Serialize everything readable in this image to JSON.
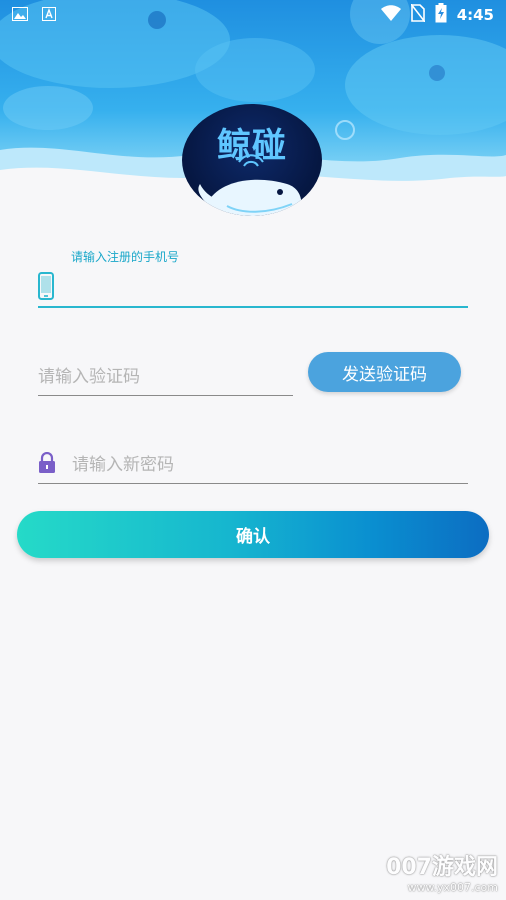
{
  "app": {
    "logo_text": "鲸碰"
  },
  "status_bar": {
    "time": "4:45",
    "icons": [
      "image-icon",
      "font-icon",
      "wifi-icon",
      "no-sim-icon",
      "battery-charging-icon"
    ]
  },
  "form": {
    "phone": {
      "label": "请输入注册的手机号",
      "value": ""
    },
    "code": {
      "placeholder": "请输入验证码",
      "send_button": "发送验证码"
    },
    "password": {
      "placeholder": "请输入新密码"
    },
    "confirm_button": "确认"
  },
  "colors": {
    "accent": "#29b7cf",
    "send_button": "#4ba3de",
    "confirm_gradient_start": "#25dac8",
    "confirm_gradient_end": "#0c6dc2",
    "lock_icon": "#7a5fc8"
  },
  "watermark": {
    "title": "007游戏网",
    "url": "www.yx007.com"
  }
}
